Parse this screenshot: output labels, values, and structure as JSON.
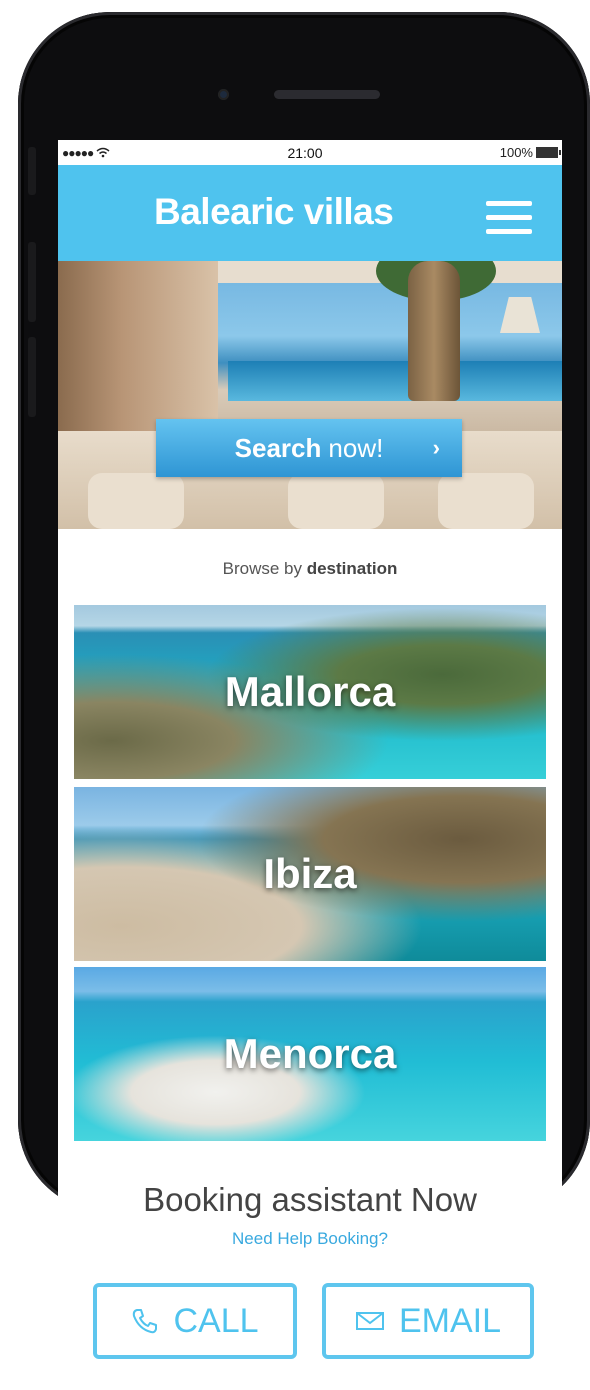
{
  "status_bar": {
    "time": "21:00",
    "battery": "100%"
  },
  "header": {
    "brand": "Balearic villas",
    "menu_icon": "hamburger-menu-icon"
  },
  "hero": {
    "search_strong": "Search",
    "search_light": "now!",
    "chevron": "›"
  },
  "browse": {
    "prefix": "Browse by",
    "bold": "destination"
  },
  "destinations": [
    {
      "label": "Mallorca"
    },
    {
      "label": "Ibiza"
    },
    {
      "label": "Menorca"
    }
  ],
  "assistant": {
    "title": "Booking assistant Now",
    "help_link": "Need Help Booking?",
    "call_label": "CALL",
    "email_label": "EMAIL"
  },
  "colors": {
    "accent": "#4fc3ee",
    "link": "#39a9df"
  }
}
